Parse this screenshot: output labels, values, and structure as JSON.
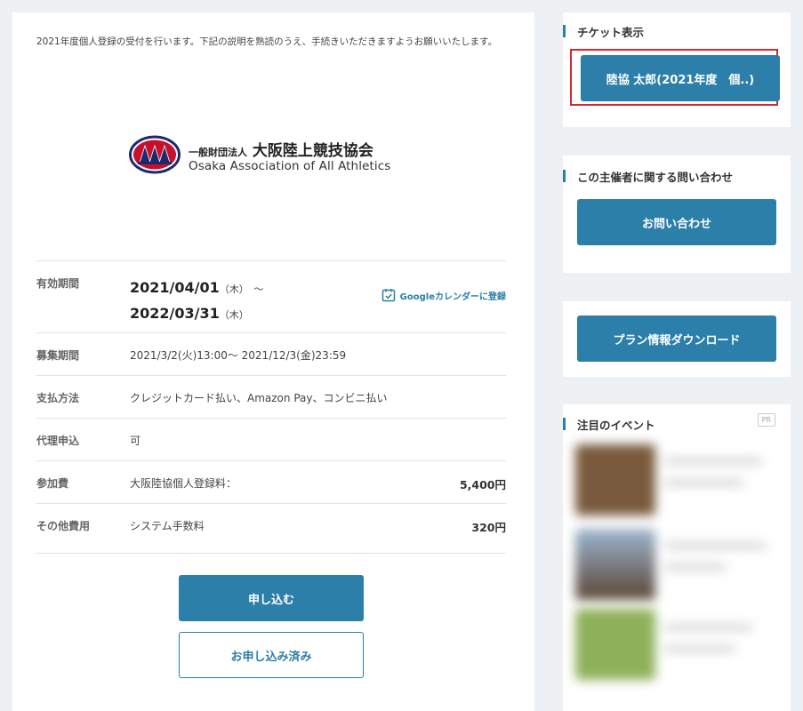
{
  "intro_text": "2021年度個人登録の受付を行います。下記の説明を熟読のうえ、手続きいただきますようお願いいたします。",
  "logo": {
    "org_prefix": "一般財団法人",
    "org_name": "大阪陸上競技協会",
    "org_name_en": "Osaka Association of All Athletics"
  },
  "period": {
    "label": "有効期間",
    "start_date": "2021/04/01",
    "start_dow": "（木）",
    "tilde": "～",
    "end_date": "2022/03/31",
    "end_dow": "（木）",
    "gcal_label": "Googleカレンダーに登録"
  },
  "rows": [
    {
      "label": "募集期間",
      "value": "2021/3/2(火)13:00～ 2021/12/3(金)23:59",
      "amount": ""
    },
    {
      "label": "支払方法",
      "value": "クレジットカード払い、Amazon Pay、コンビニ払い",
      "amount": ""
    },
    {
      "label": "代理申込",
      "value": "可",
      "amount": ""
    },
    {
      "label": "参加費",
      "value": "大阪陸協個人登録料：",
      "amount": "5,400円"
    },
    {
      "label": "その他費用",
      "value": "システム手数料",
      "amount": "320円"
    }
  ],
  "buttons": {
    "apply": "申し込む",
    "applied": "お申し込み済み"
  },
  "sidebar": {
    "ticket_title": "チケット表示",
    "ticket_button": "陸協 太郎(2021年度　個..)",
    "contact_title": "この主催者に関する問い合わせ",
    "contact_button": "お問い合わせ",
    "download_button": "プラン情報ダウンロード",
    "featured_title": "注目のイベント",
    "pr_badge": "PR"
  },
  "colors": {
    "accent": "#2b7fa8",
    "highlight": "#d9262f",
    "logo_red": "#c8102e",
    "logo_navy": "#1c2a6b"
  }
}
